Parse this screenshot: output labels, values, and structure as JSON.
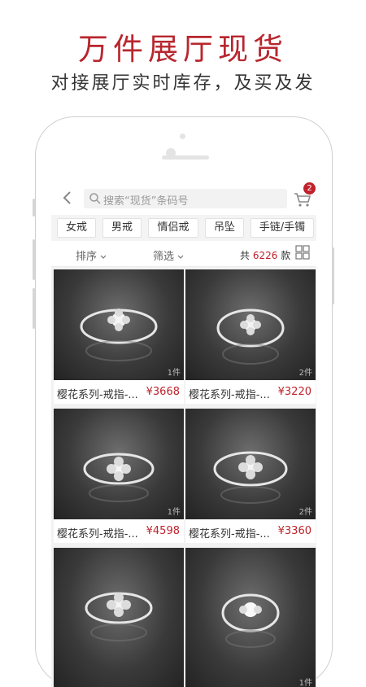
{
  "promo": {
    "headline": "万件展厅现货",
    "subline": "对接展厅实时库存，及买及发"
  },
  "search": {
    "placeholder": "搜索“现货”条码号"
  },
  "cart": {
    "badge": "2"
  },
  "categories": [
    "女戒",
    "男戒",
    "情侣戒",
    "吊坠",
    "手链/手镯"
  ],
  "filters": {
    "sort": "排序",
    "filter": "筛选",
    "count_prefix": "共",
    "count_value": "6226",
    "count_suffix": "款"
  },
  "products": [
    {
      "title": "樱花系列-戒指-...",
      "price": "¥3668",
      "qty": "1件"
    },
    {
      "title": "樱花系列-戒指-...",
      "price": "¥3220",
      "qty": "2件"
    },
    {
      "title": "樱花系列-戒指-...",
      "price": "¥4598",
      "qty": "1件"
    },
    {
      "title": "樱花系列-戒指-...",
      "price": "¥3360",
      "qty": "2件"
    },
    {
      "title": "",
      "price": "",
      "qty": ""
    },
    {
      "title": "",
      "price": "",
      "qty": "1件"
    }
  ],
  "colors": {
    "brand_red": "#c0222c",
    "headline_red": "#b8262e"
  }
}
